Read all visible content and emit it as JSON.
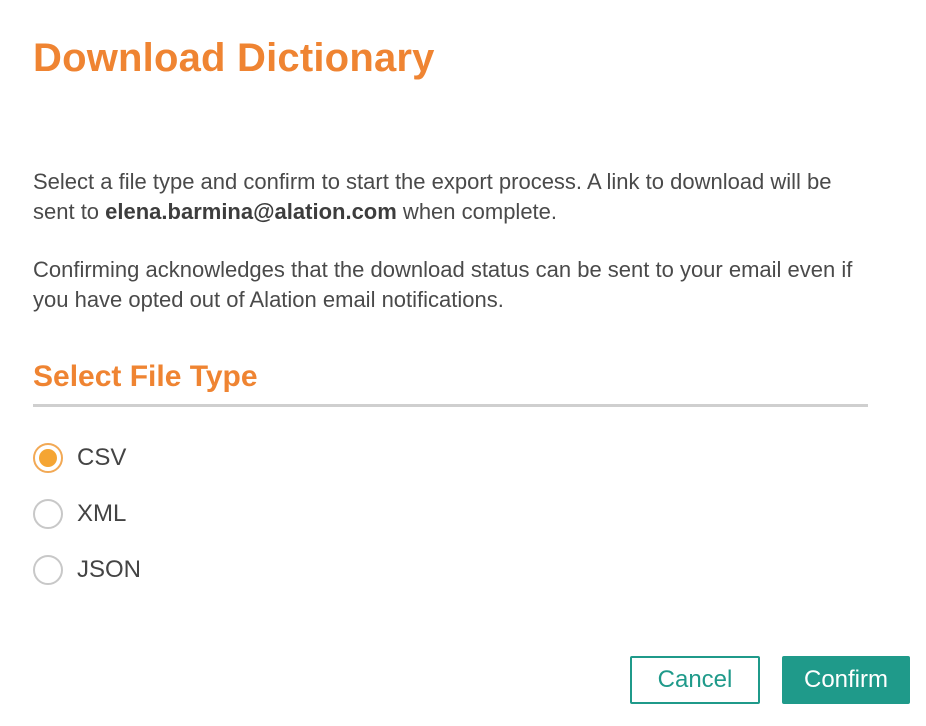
{
  "dialog": {
    "title": "Download Dictionary",
    "intro_part1": "Select a file type and confirm to start the export process. A link to download will be sent to ",
    "intro_email": "elena.barmina@alation.com",
    "intro_part2": " when complete.",
    "acknowledgement": "Confirming acknowledges that the download status can be sent to your email even if you have opted out of Alation email notifications."
  },
  "file_type": {
    "heading": "Select File Type",
    "selected": "CSV",
    "options": [
      {
        "label": "CSV",
        "checked": true
      },
      {
        "label": "XML",
        "checked": false
      },
      {
        "label": "JSON",
        "checked": false
      }
    ]
  },
  "buttons": {
    "cancel_label": "Cancel",
    "confirm_label": "Confirm"
  },
  "colors": {
    "accent_orange": "#ef8432",
    "radio_selected": "#f5a533",
    "button_teal": "#1f9a8a"
  }
}
